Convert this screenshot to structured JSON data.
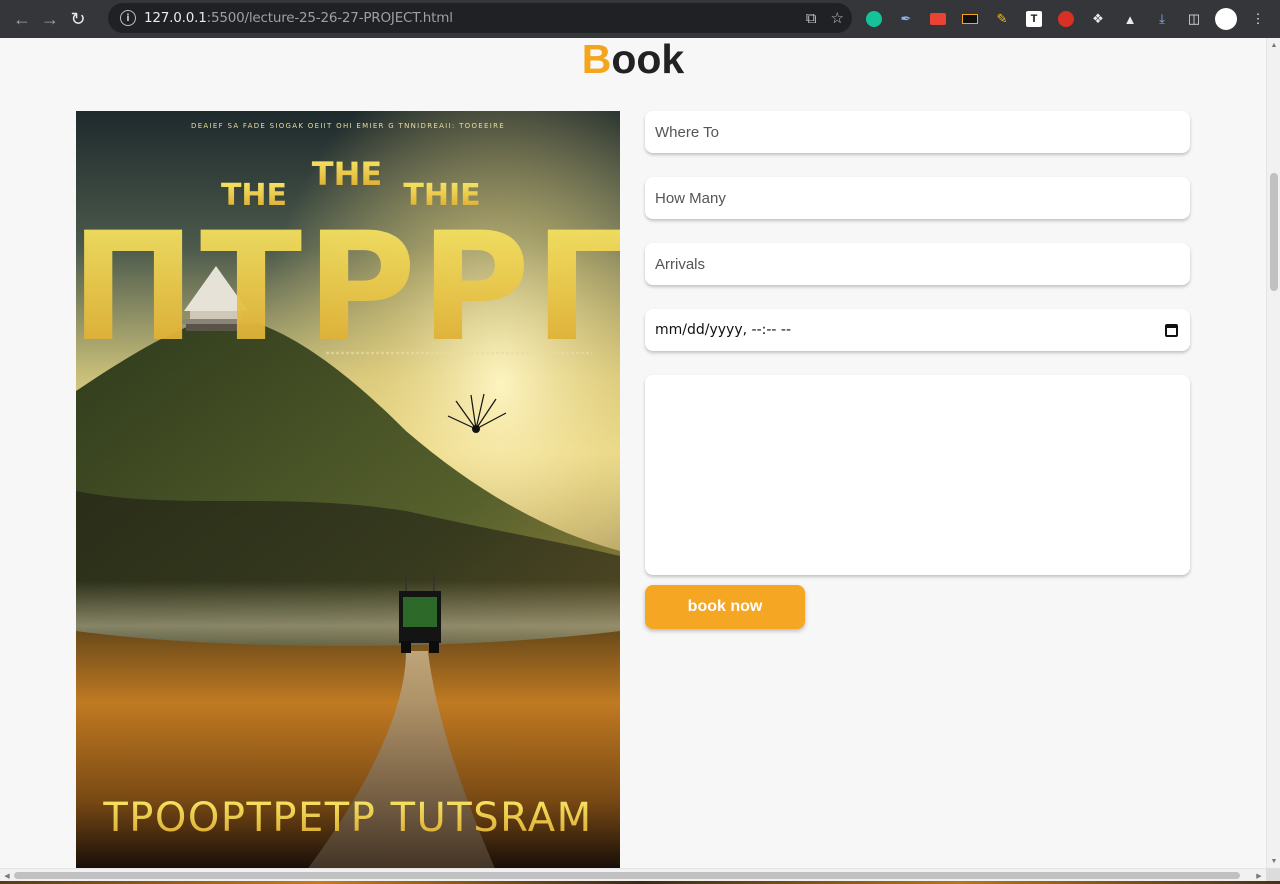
{
  "browser": {
    "url_host": "127.0.0.1",
    "url_rest": ":5500/lecture-25-26-27-PROJECT.html"
  },
  "page": {
    "heading_accent": "B",
    "heading_rest": "ook",
    "accent_color": "#f3a51c"
  },
  "poster": {
    "top_tiny_text": "DEAIEF SA FADE SIOGAK OEIIT OHI EMIER G TNNIDREAII: TOOEEIRE",
    "word_the_left": "THE",
    "word_the_center": "THE",
    "word_thie": "THIE",
    "big_title": "ПТРРГ",
    "bottom_title": "TPOOPTPETP TUTSRAM"
  },
  "form": {
    "where_to_placeholder": "Where To",
    "how_many_placeholder": "How Many",
    "arrivals_placeholder": "Arrivals",
    "date_placeholder": "mm/dd/yyyy, --:-- --",
    "submit_label": "book now",
    "button_color": "#f5a623"
  }
}
